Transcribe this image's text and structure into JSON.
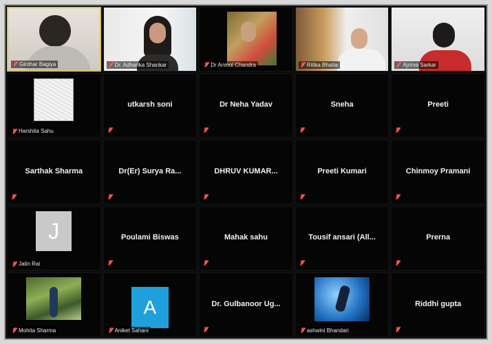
{
  "participants": [
    {
      "id": "p1",
      "name": "Girdhar Bagiya",
      "mode": "video",
      "variant": "v1",
      "active": true
    },
    {
      "id": "p2",
      "name": "Dr. Adharika Shankar",
      "mode": "video",
      "variant": "v2"
    },
    {
      "id": "p3",
      "name": "Dr Anmol Chandra",
      "mode": "video",
      "variant": "v3"
    },
    {
      "id": "p4",
      "name": "Ritika Bhatia",
      "mode": "video",
      "variant": "v4"
    },
    {
      "id": "p5",
      "name": "Ajrima Sarkar",
      "mode": "video",
      "variant": "v5"
    },
    {
      "id": "p6",
      "name": "Harshita Sahu",
      "mode": "thumb",
      "thumb": "sketch"
    },
    {
      "id": "p7",
      "name": "utkarsh soni",
      "mode": "name"
    },
    {
      "id": "p8",
      "name": "Dr Neha Yadav",
      "mode": "name"
    },
    {
      "id": "p9",
      "name": "Sneha",
      "mode": "name"
    },
    {
      "id": "p10",
      "name": "Preeti",
      "mode": "name"
    },
    {
      "id": "p11",
      "name": "Sarthak Sharma",
      "mode": "name"
    },
    {
      "id": "p12",
      "name": "Dr(Er) Surya Ra...",
      "mode": "name"
    },
    {
      "id": "p13",
      "name": "DHRUV KUMAR...",
      "mode": "name"
    },
    {
      "id": "p14",
      "name": "Preeti Kumari",
      "mode": "name"
    },
    {
      "id": "p15",
      "name": "Chinmoy Pramani",
      "mode": "name"
    },
    {
      "id": "p16",
      "name": "Jatin Rai",
      "mode": "thumb",
      "thumb": "letterbox",
      "initial": "J"
    },
    {
      "id": "p17",
      "name": "Poulami Biswas",
      "mode": "name"
    },
    {
      "id": "p18",
      "name": "Mahak sahu",
      "mode": "name"
    },
    {
      "id": "p19",
      "name": "Tousif ansari (All...",
      "mode": "name"
    },
    {
      "id": "p20",
      "name": "Prerna",
      "mode": "name"
    },
    {
      "id": "p21",
      "name": "Mohita Sharma",
      "mode": "thumb",
      "thumb": "nature"
    },
    {
      "id": "p22",
      "name": "Aniket Sahani",
      "mode": "thumb",
      "thumb": "avatarA",
      "initial": "A"
    },
    {
      "id": "p23",
      "name": "Dr. Gulbanoor Ug...",
      "mode": "name"
    },
    {
      "id": "p24",
      "name": "ashwini Bhandari",
      "mode": "thumb",
      "thumb": "blue"
    },
    {
      "id": "p25",
      "name": "Riddhi gupta",
      "mode": "name"
    }
  ]
}
